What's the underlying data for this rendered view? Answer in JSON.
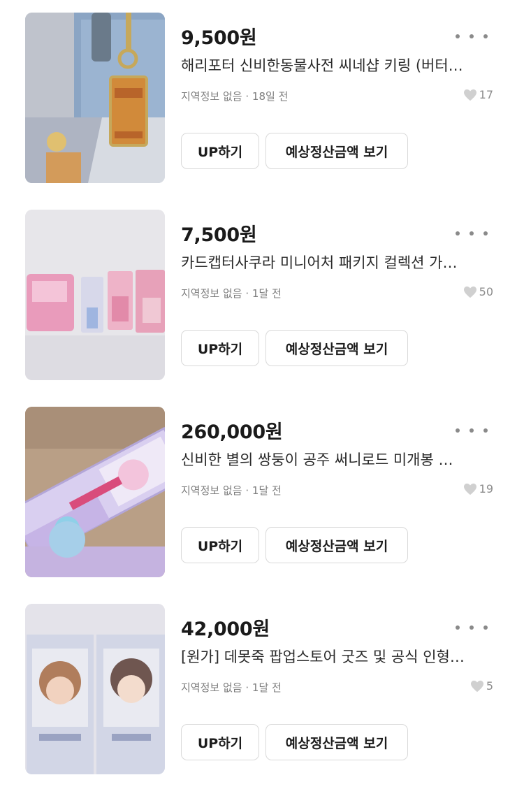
{
  "listings": [
    {
      "price": "9,500원",
      "title": "해리포터 신비한동물사전 씨네샵 키링 (버터…",
      "location": "지역정보 없음",
      "time": "18일 전",
      "likes": "17",
      "up_label": "UP하기",
      "estimate_label": "예상정산금액 보기",
      "thumb_icon": "harry-potter-keyring-photo"
    },
    {
      "price": "7,500원",
      "title": "카드캡터사쿠라 미니어처 패키지 컬렉션 가…",
      "location": "지역정보 없음",
      "time": "1달 전",
      "likes": "50",
      "up_label": "UP하기",
      "estimate_label": "예상정산금액 보기",
      "thumb_icon": "cardcaptor-sakura-miniatures-photo"
    },
    {
      "price": "260,000원",
      "title": "신비한 별의 쌍둥이 공주 써니로드 미개봉 …",
      "location": "지역정보 없음",
      "time": "1달 전",
      "likes": "19",
      "up_label": "UP하기",
      "estimate_label": "예상정산금액 보기",
      "thumb_icon": "magic-wand-toy-box-photo"
    },
    {
      "price": "42,000원",
      "title": "[원가] 데못죽 팝업스토어 굿즈 및 공식 인형…",
      "location": "지역정보 없음",
      "time": "1달 전",
      "likes": "5",
      "up_label": "UP하기",
      "estimate_label": "예상정산금액 보기",
      "thumb_icon": "doll-boxes-photo"
    }
  ],
  "meta_separator": "·",
  "colors": {
    "text": "#1a1a1a",
    "muted": "#7d7d7d",
    "border": "#d9d9d9",
    "heart": "#d0d0d0"
  }
}
